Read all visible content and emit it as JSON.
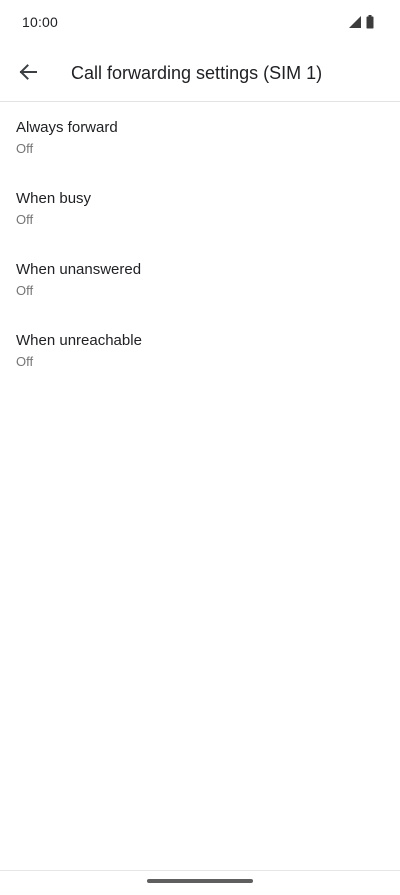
{
  "status_bar": {
    "time": "10:00",
    "icons": [
      "signal-icon",
      "battery-icon"
    ]
  },
  "app_bar": {
    "back_icon": "arrow-back-icon",
    "title": "Call forwarding settings (SIM 1)"
  },
  "settings": [
    {
      "title": "Always forward",
      "summary": "Off"
    },
    {
      "title": "When busy",
      "summary": "Off"
    },
    {
      "title": "When unanswered",
      "summary": "Off"
    },
    {
      "title": "When unreachable",
      "summary": "Off"
    }
  ],
  "colors": {
    "background": "#ffffff",
    "primary_text": "#202124",
    "secondary_text": "#757575",
    "divider": "#e3e3e3",
    "nav_handle": "#5f5f5f"
  }
}
